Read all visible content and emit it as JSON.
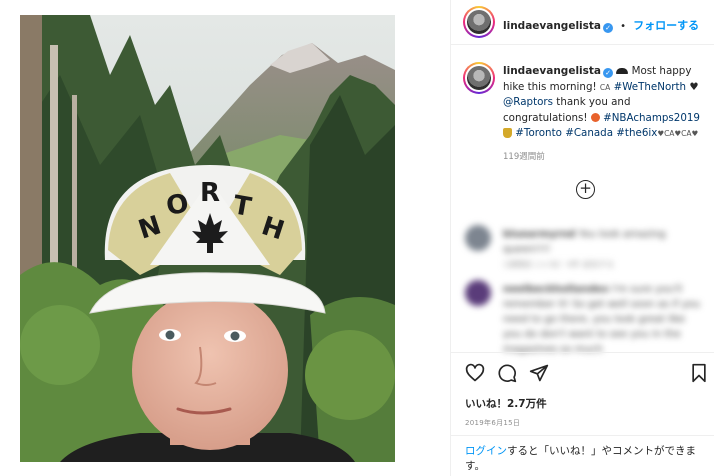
{
  "post": {
    "username": "lindaevangelista",
    "verified": true,
    "separator": "•",
    "follow_label": "フォローする",
    "caption": {
      "text_1": "Most happy hike this morning!",
      "flag_text": "CA",
      "hashtag_1": "#WeTheNorth",
      "heart": "♥",
      "mention": "@Raptors",
      "text_2": "thank you and congratulations!",
      "hashtag_2": "#NBAchamps2019",
      "hashtag_3": "#Toronto",
      "hashtag_4": "#Canada",
      "hashtag_5": "#the6ix",
      "tail": "♥CA♥CA♥"
    },
    "time_ago": "119週間前",
    "likes_label": "いいね！2.7万件",
    "date_label": "2019年6月15日",
    "login_link": "ログイン",
    "login_text": "すると「いいね！」やコメントができます。"
  },
  "photo": {
    "cap_text": "NORTH",
    "cap_emblem": "maple-leaf"
  },
  "comments": [
    {
      "user": "bluearmyrnd",
      "text": "You look amazing queen!!!!",
      "meta": "1週間前  いいね！4件  返信する",
      "avatar_color": "#7d8590"
    },
    {
      "user": "neelbeckhollandex",
      "text": "I'm sure you'll remember it! So get well soon as if you need to go there, you look great like you do don't want to see you in the magazines so much",
      "meta": "",
      "avatar_color": "#5a3c7a"
    }
  ],
  "colors": {
    "accent": "#0095f6",
    "link": "#00376b",
    "muted": "#8e8e8e"
  },
  "icons": [
    "heart-icon",
    "comment-icon",
    "share-icon",
    "bookmark-icon",
    "add-comment-icon"
  ]
}
